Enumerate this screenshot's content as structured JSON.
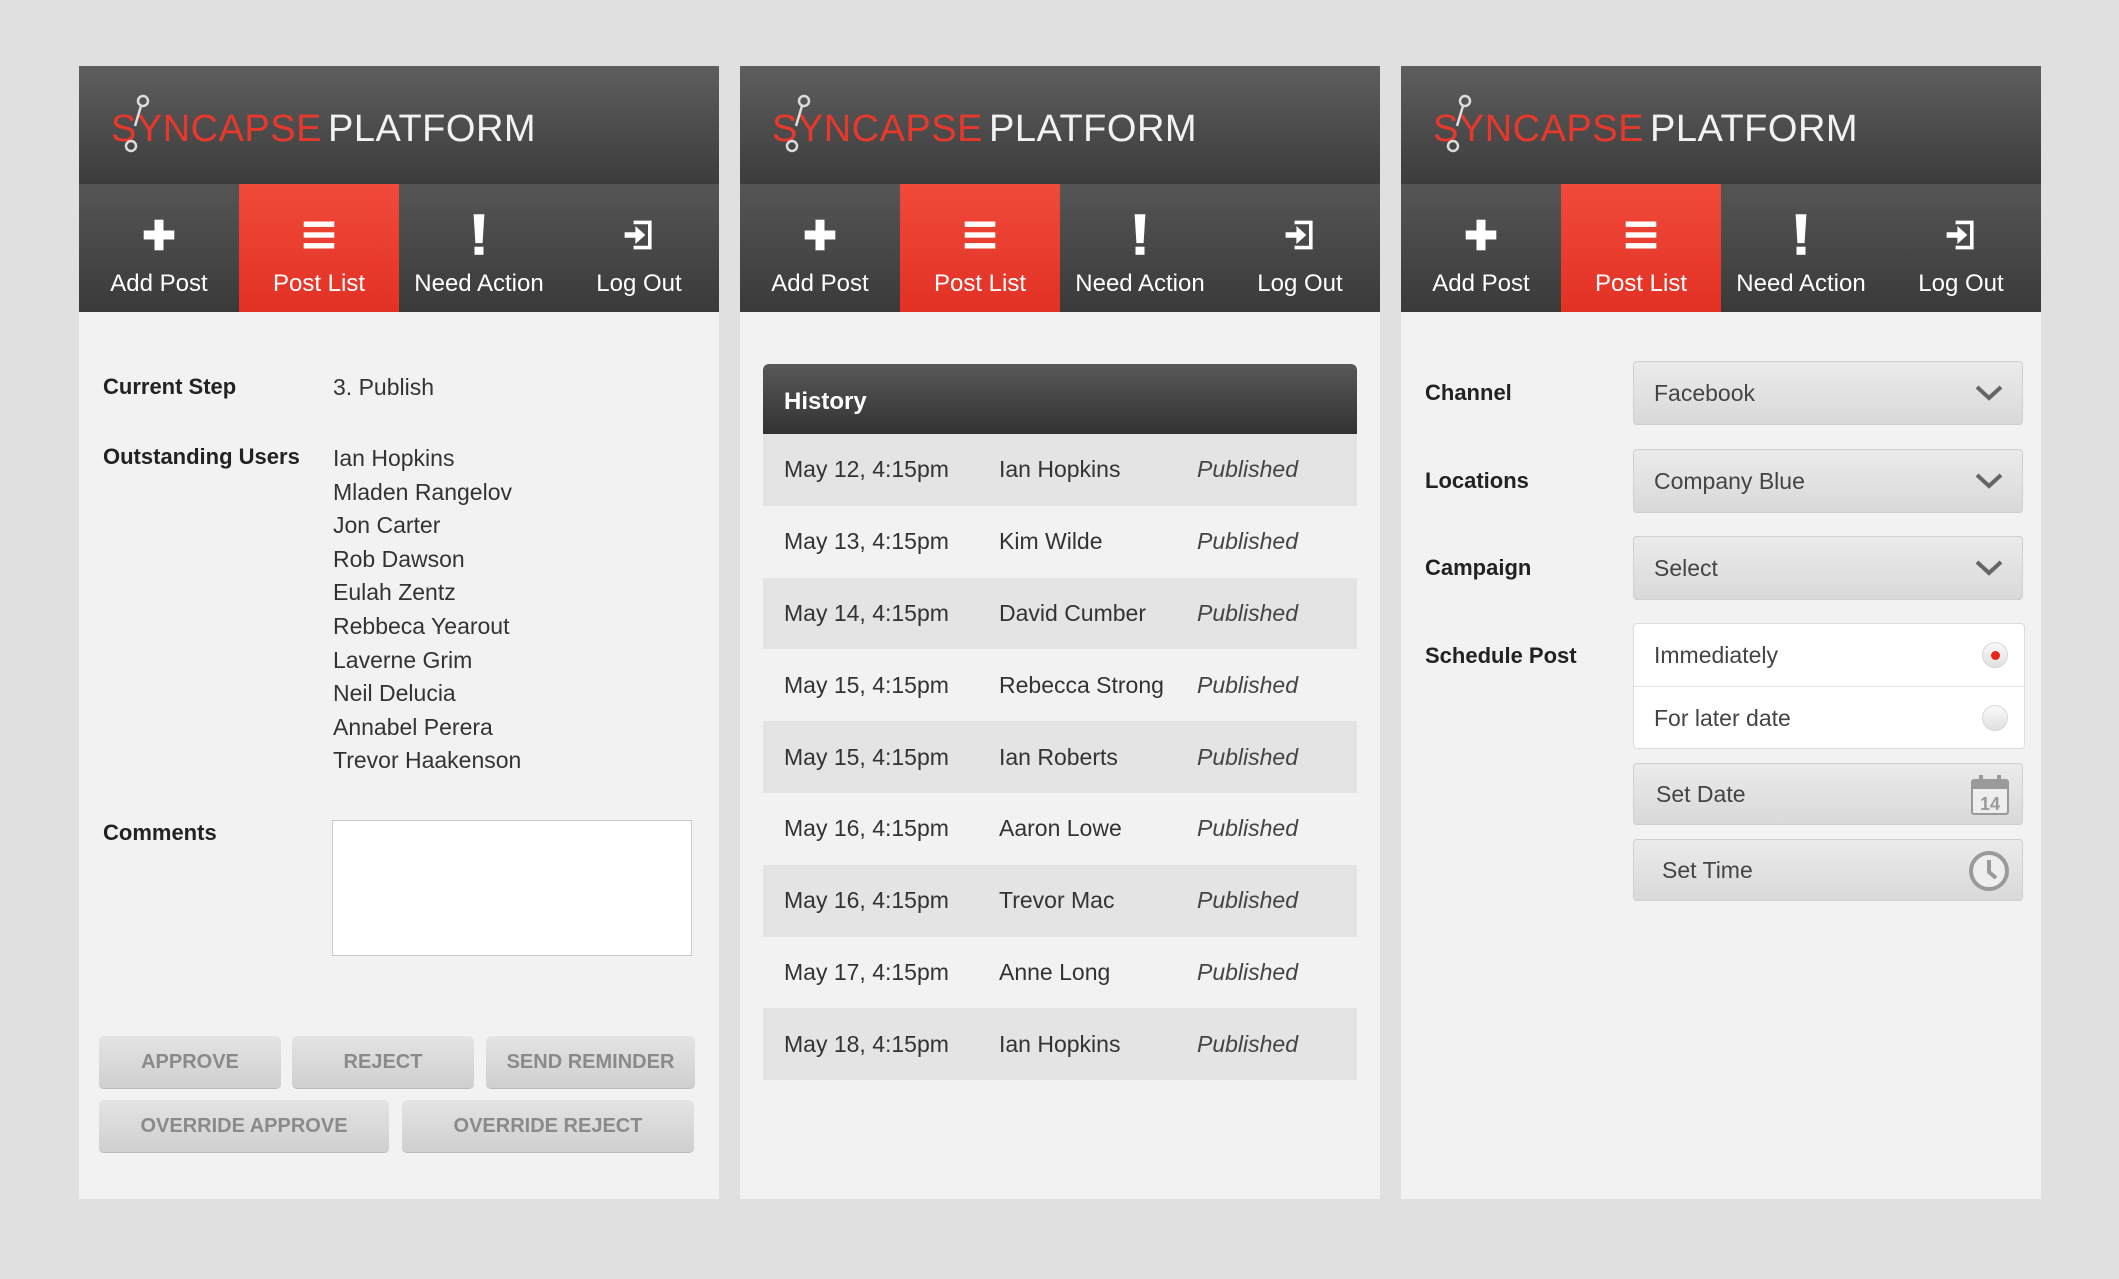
{
  "app": {
    "brand": "SYNCAPSE",
    "platform": "PLATFORM"
  },
  "nav": [
    {
      "label": "Add Post",
      "icon": "plus-icon"
    },
    {
      "label": "Post List",
      "icon": "list-icon",
      "active": true
    },
    {
      "label": "Need Action",
      "icon": "exclamation-icon"
    },
    {
      "label": "Log Out",
      "icon": "logout-icon"
    }
  ],
  "approval": {
    "current_step_label": "Current Step",
    "current_step_value": "3. Publish",
    "outstanding_label": "Outstanding Users",
    "outstanding_users": [
      "Ian Hopkins",
      "Mladen Rangelov",
      "Jon Carter",
      "Rob Dawson",
      "Eulah Zentz",
      "Rebbeca Yearout",
      "Laverne Grim",
      "Neil Delucia",
      "Annabel Perera",
      "Trevor Haakenson"
    ],
    "comments_label": "Comments",
    "buttons": {
      "approve": "APPROVE",
      "reject": "REJECT",
      "send_reminder": "SEND REMINDER",
      "override_approve": "OVERRIDE APPROVE",
      "override_reject": "OVERRIDE REJECT"
    }
  },
  "history": {
    "title": "History",
    "rows": [
      {
        "date": "May 12, 4:15pm",
        "user": "Ian Hopkins",
        "status": "Published"
      },
      {
        "date": "May 13, 4:15pm",
        "user": "Kim Wilde",
        "status": "Published"
      },
      {
        "date": "May 14, 4:15pm",
        "user": "David Cumber",
        "status": "Published"
      },
      {
        "date": "May 15, 4:15pm",
        "user": "Rebecca Strong",
        "status": "Published"
      },
      {
        "date": "May 15, 4:15pm",
        "user": "Ian Roberts",
        "status": "Published"
      },
      {
        "date": "May 16, 4:15pm",
        "user": "Aaron Lowe",
        "status": "Published"
      },
      {
        "date": "May 16, 4:15pm",
        "user": "Trevor Mac",
        "status": "Published"
      },
      {
        "date": "May 17, 4:15pm",
        "user": "Anne Long",
        "status": "Published"
      },
      {
        "date": "May 18, 4:15pm",
        "user": "Ian Hopkins",
        "status": "Published"
      }
    ]
  },
  "schedule": {
    "channel_label": "Channel",
    "channel_value": "Facebook",
    "locations_label": "Locations",
    "locations_value": "Company Blue",
    "campaign_label": "Campaign",
    "campaign_value": "Select",
    "schedule_label": "Schedule Post",
    "option_immediately": "Immediately",
    "option_later": "For later date",
    "selected_option": "Immediately",
    "set_date_label": "Set Date",
    "calendar_day": "14",
    "set_time_label": "Set Time"
  },
  "colors": {
    "accent": "#e8382c",
    "header": "#4a4a4a",
    "panel": "#f2f2f2"
  }
}
